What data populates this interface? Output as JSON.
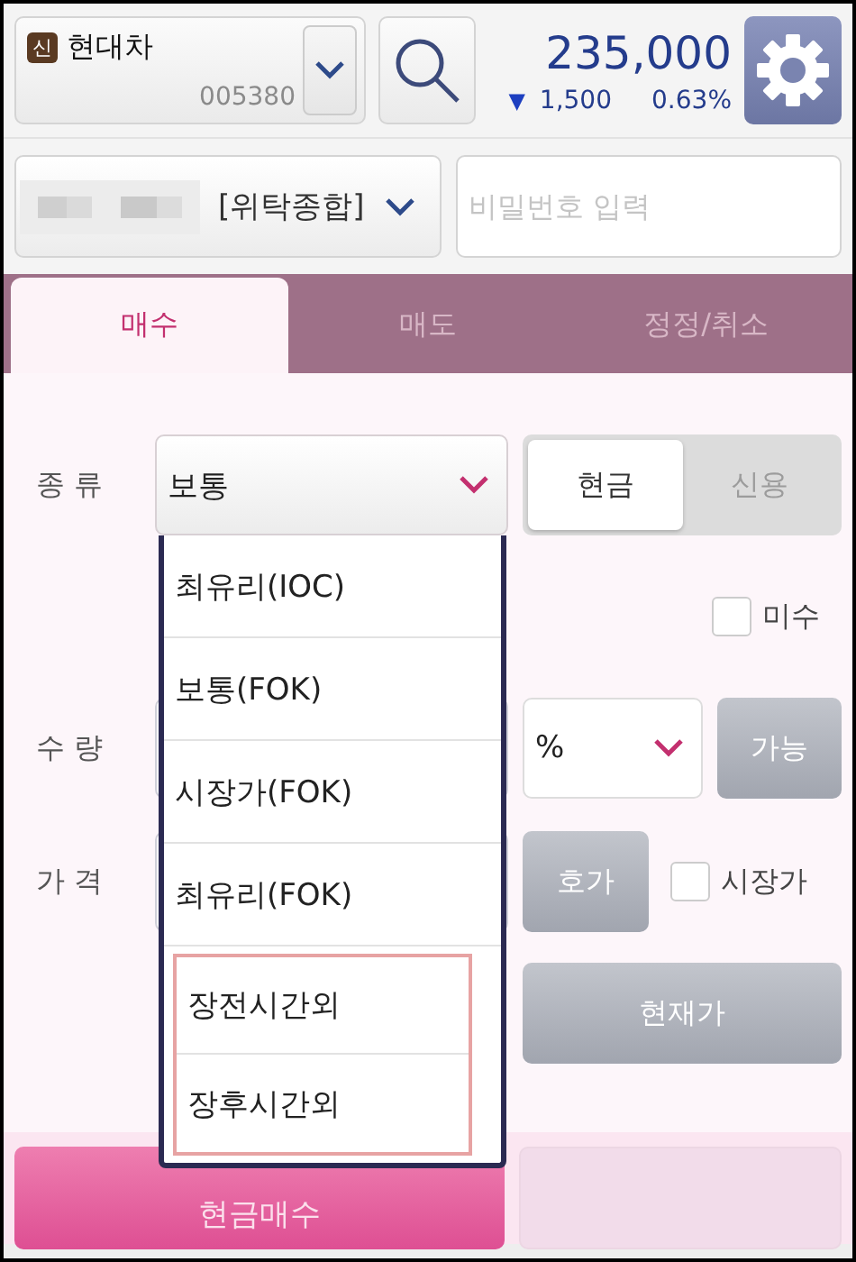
{
  "header": {
    "stock": {
      "badge": "신",
      "name": "현대차",
      "code": "005380"
    },
    "price": {
      "value": "235,000",
      "direction": "▼",
      "change": "1,500",
      "rate": "0.63%"
    }
  },
  "account": {
    "kind_label": "[위탁종합]"
  },
  "password": {
    "placeholder": "비밀번호 입력"
  },
  "tabs": [
    {
      "label": "매수",
      "selected": true
    },
    {
      "label": "매도",
      "selected": false
    },
    {
      "label": "정정/취소",
      "selected": false
    }
  ],
  "form": {
    "type_label": "종 류",
    "type_value": "보통",
    "credit_options": [
      {
        "label": "현금",
        "selected": true
      },
      {
        "label": "신용",
        "selected": false
      }
    ],
    "margin_checkbox": {
      "label": "미수",
      "checked": false
    },
    "quantity_label": "수 량",
    "quantity_unit": "%",
    "available_button": "가능",
    "price_label": "가 격",
    "quote_button": "호가",
    "market_checkbox": {
      "label": "시장가",
      "checked": false
    },
    "current_price_button": "현재가"
  },
  "order_type_dropdown": [
    {
      "label": "최유리(IOC)",
      "highlighted": false
    },
    {
      "label": "보통(FOK)",
      "highlighted": false
    },
    {
      "label": "시장가(FOK)",
      "highlighted": false
    },
    {
      "label": "최유리(FOK)",
      "highlighted": false
    },
    {
      "label": "장전시간외",
      "highlighted": true
    },
    {
      "label": "장후시간외",
      "highlighted": true
    }
  ],
  "bottom": {
    "submit_button": "현금매수"
  }
}
